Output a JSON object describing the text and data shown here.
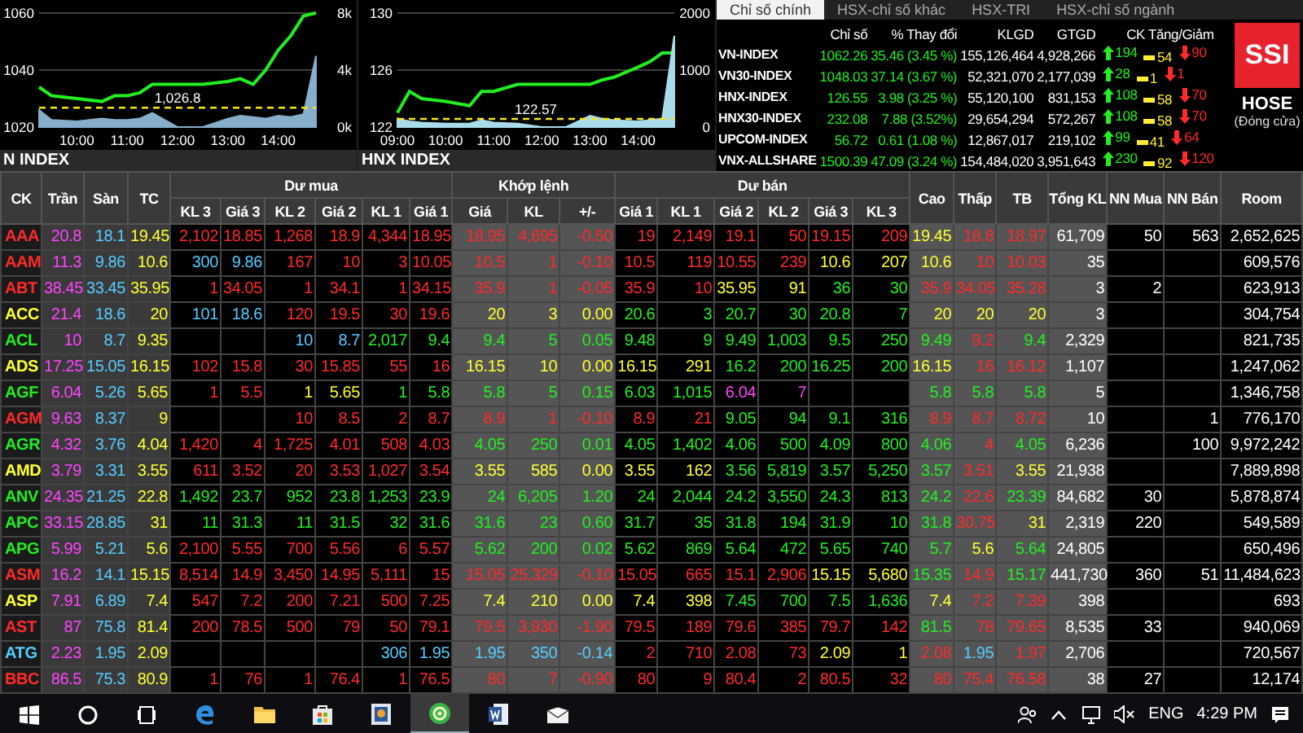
{
  "charts": [
    {
      "label": "N INDEX",
      "chart_data": {
        "type": "line",
        "xlim": [
          9.25,
          14.75
        ],
        "ylim": [
          1020,
          1060
        ],
        "xticks": [
          {
            "value": 10,
            "label": "10:00"
          },
          {
            "value": 11,
            "label": "11:00"
          },
          {
            "value": 12,
            "label": "12:00"
          },
          {
            "value": 13,
            "label": "13:00"
          },
          {
            "value": 14,
            "label": "14:00"
          }
        ],
        "yticks": [
          1020,
          1040,
          1060
        ],
        "y2lim": [
          0,
          8000
        ],
        "y2ticks": [
          {
            "value": 0,
            "label": "0k"
          },
          {
            "value": 4000,
            "label": "4k"
          },
          {
            "value": 8000,
            "label": "8k"
          }
        ],
        "x": [
          9.25,
          9.5,
          10,
          10.5,
          10.75,
          11,
          11.25,
          11.5,
          12,
          12.5,
          13,
          13.25,
          13.5,
          13.75,
          14,
          14.25,
          14.5,
          14.75
        ],
        "series": [
          {
            "color": "#22ee22",
            "values": [
              1034,
              1031,
              1030,
              1029,
              1031,
              1031,
              1032,
              1035,
              1035,
              1035,
              1036,
              1037,
              1035,
              1040,
              1047,
              1052,
              1059,
              1060
            ]
          },
          {
            "type": "area",
            "axis": "y2",
            "color": "#86aecb",
            "values": [
              1200,
              500,
              400,
              600,
              500,
              500,
              600,
              1000,
              0,
              0,
              600,
              800,
              700,
              600,
              800,
              700,
              900,
              5000
            ]
          },
          {
            "name": "1,026.8",
            "line_style": "dashed",
            "color": "#f5e51a",
            "values": [
              1026.8,
              1026.8,
              1026.8,
              1026.8,
              1026.8,
              1026.8,
              1026.8,
              1026.8,
              1026.8,
              1026.8,
              1026.8,
              1026.8,
              1026.8,
              1026.8,
              1026.8,
              1026.8,
              1026.8,
              1026.8
            ]
          }
        ]
      }
    },
    {
      "label": "HNX INDEX",
      "chart_data": {
        "type": "line",
        "xlim": [
          9,
          14.75
        ],
        "ylim": [
          122,
          130
        ],
        "xticks": [
          {
            "value": 9,
            "label": "09:00"
          },
          {
            "value": 10,
            "label": "10:00"
          },
          {
            "value": 11,
            "label": "11:00"
          },
          {
            "value": 12,
            "label": "12:00"
          },
          {
            "value": 13,
            "label": "13:00"
          },
          {
            "value": 14,
            "label": "14:00"
          }
        ],
        "yticks": [
          122,
          126,
          130
        ],
        "y2lim": [
          0,
          2000
        ],
        "y2ticks": [
          0,
          1000,
          2000
        ],
        "x": [
          9,
          9.25,
          9.5,
          10,
          10.5,
          10.75,
          11,
          11.5,
          12,
          12.5,
          13,
          13.25,
          13.5,
          14,
          14.25,
          14.5,
          14.75
        ],
        "series": [
          {
            "color": "#22ee22",
            "values": [
              123,
              124.5,
              124,
              123.8,
              123.5,
              124.5,
              124.5,
              125,
              125,
              125,
              125,
              125.3,
              125.5,
              126.2,
              126.6,
              127.2,
              127.2
            ]
          },
          {
            "type": "area",
            "axis": "y2",
            "color": "#a8dcea",
            "values": [
              150,
              100,
              80,
              60,
              60,
              120,
              80,
              60,
              0,
              0,
              200,
              150,
              120,
              100,
              120,
              150,
              1600
            ]
          },
          {
            "name": "122.57",
            "line_style": "dashed",
            "color": "#f5e51a",
            "values": [
              122.57,
              122.57,
              122.57,
              122.57,
              122.57,
              122.57,
              122.57,
              122.57,
              122.57,
              122.57,
              122.57,
              122.57,
              122.57,
              122.57,
              122.57,
              122.57,
              122.57
            ]
          }
        ]
      }
    }
  ],
  "index_panel": {
    "tabs": [
      {
        "label": "Chỉ số chính",
        "selected": true
      },
      {
        "label": "HSX-chỉ số khác",
        "selected": false
      },
      {
        "label": "HSX-TRI",
        "selected": false
      },
      {
        "label": "HSX-chỉ số ngành",
        "selected": false
      }
    ],
    "columns": [
      "Chỉ số",
      "% Thay đổi",
      "KLGD",
      "GTGD",
      "CK Tăng/Giảm"
    ],
    "rows": [
      {
        "name": "VN-INDEX",
        "value": "1062.26",
        "change": "35.46 (3.45 %)",
        "klgd": "155,126,464",
        "gtgd": "4,928,266",
        "up": "194",
        "flat": "54",
        "down": "90"
      },
      {
        "name": "VN30-INDEX",
        "value": "1048.03",
        "change": "37.14 (3.67 %)",
        "klgd": "52,321,070",
        "gtgd": "2,177,039",
        "up": "28",
        "flat": "1",
        "down": "1"
      },
      {
        "name": "HNX-INDEX",
        "value": "126.55",
        "change": "3.98 (3.25 %)",
        "klgd": "55,120,100",
        "gtgd": "831,153",
        "up": "108",
        "flat": "58",
        "down": "70"
      },
      {
        "name": "HNX30-INDEX",
        "value": "232.08",
        "change": "7.88 (3.52%)",
        "klgd": "29,654,294",
        "gtgd": "572,267",
        "up": "108",
        "flat": "58",
        "down": "70"
      },
      {
        "name": "UPCOM-INDEX",
        "value": "56.72",
        "change": "0.61 (1.08 %)",
        "klgd": "12,867,017",
        "gtgd": "219,102",
        "up": "99",
        "flat": "41",
        "down": "64"
      },
      {
        "name": "VNX-ALLSHARE",
        "value": "1500.39",
        "change": "47.09 (3.24 %)",
        "klgd": "154,484,020",
        "gtgd": "3,951,643",
        "up": "230",
        "flat": "92",
        "down": "120"
      }
    ],
    "logo": "SSI",
    "exchange": "HOSE",
    "status": "(Đóng cửa)"
  },
  "board": {
    "header": [
      {
        "label": "CK"
      },
      {
        "label": "Trần"
      },
      {
        "label": "Sàn"
      },
      {
        "label": "TC"
      },
      {
        "label": "Dư mua",
        "columns": [
          "KL 3",
          "Giá 3",
          "KL 2",
          "Giá 2",
          "KL 1",
          "Giá 1"
        ]
      },
      {
        "label": "Khớp lệnh",
        "columns": [
          "Giá",
          "KL",
          "+/-"
        ]
      },
      {
        "label": "Dư bán",
        "columns": [
          "Giá 1",
          "KL 1",
          "Giá 2",
          "KL 2",
          "Giá 3",
          "KL 3"
        ]
      },
      {
        "label": "Cao"
      },
      {
        "label": "Thấp"
      },
      {
        "label": "TB"
      },
      {
        "label": "Tổng KL"
      },
      {
        "label": "NN Mua"
      },
      {
        "label": "NN Bán"
      },
      {
        "label": "Room"
      }
    ],
    "rows": [
      [
        "AAA",
        "20.8",
        "18.1",
        "19.45",
        "2,102",
        "18.85",
        "1,268",
        "18.9",
        "4,344",
        "18.95",
        "18.95",
        "4,695",
        "-0.50",
        "19",
        "2,149",
        "19.1",
        "50",
        "19.15",
        "209",
        "19.45",
        "18.8",
        "18.97",
        "61,709",
        "50",
        "563",
        "2,652,625"
      ],
      [
        "AAM",
        "11.3",
        "9.86",
        "10.6",
        "300",
        "9.86",
        "167",
        "10",
        "3",
        "10.05",
        "10.5",
        "1",
        "-0.10",
        "10.5",
        "119",
        "10.55",
        "239",
        "10.6",
        "207",
        "10.6",
        "10",
        "10.03",
        "35",
        null,
        null,
        "609,576"
      ],
      [
        "ABT",
        "38.45",
        "33.45",
        "35.95",
        "1",
        "34.05",
        "1",
        "34.1",
        "1",
        "34.15",
        "35.9",
        "1",
        "-0.05",
        "35.9",
        "10",
        "35.95",
        "91",
        "36",
        "30",
        "35.9",
        "34.05",
        "35.28",
        "3",
        "2",
        null,
        "623,913"
      ],
      [
        "ACC",
        "21.4",
        "18.6",
        "20",
        "101",
        "18.6",
        "120",
        "19.5",
        "30",
        "19.6",
        "20",
        "3",
        "0.00",
        "20.6",
        "3",
        "20.7",
        "30",
        "20.8",
        "7",
        "20",
        "20",
        "20",
        "3",
        null,
        null,
        "304,754"
      ],
      [
        "ACL",
        "10",
        "8.7",
        "9.35",
        null,
        null,
        "10",
        "8.7",
        "2,017",
        "9.4",
        "9.4",
        "5",
        "0.05",
        "9.48",
        "9",
        "9.49",
        "1,003",
        "9.5",
        "250",
        "9.49",
        "9.2",
        "9.4",
        "2,329",
        null,
        null,
        "821,735"
      ],
      [
        "ADS",
        "17.25",
        "15.05",
        "16.15",
        "102",
        "15.8",
        "30",
        "15.85",
        "55",
        "16",
        "16.15",
        "10",
        "0.00",
        "16.15",
        "291",
        "16.2",
        "200",
        "16.25",
        "200",
        "16.15",
        "16",
        "16.12",
        "1,107",
        null,
        null,
        "1,247,062"
      ],
      [
        "AGF",
        "6.04",
        "5.26",
        "5.65",
        "1",
        "5.5",
        "1",
        "5.65",
        "1",
        "5.8",
        "5.8",
        "5",
        "0.15",
        "6.03",
        "1,015",
        "6.04",
        "7",
        null,
        null,
        "5.8",
        "5.8",
        "5.8",
        "5",
        null,
        null,
        "1,346,758"
      ],
      [
        "AGM",
        "9.63",
        "8.37",
        "9",
        null,
        null,
        "10",
        "8.5",
        "2",
        "8.7",
        "8.9",
        "1",
        "-0.10",
        "8.9",
        "21",
        "9.05",
        "94",
        "9.1",
        "316",
        "8.9",
        "8.7",
        "8.72",
        "10",
        null,
        "1",
        "776,170"
      ],
      [
        "AGR",
        "4.32",
        "3.76",
        "4.04",
        "1,420",
        "4",
        "1,725",
        "4.01",
        "508",
        "4.03",
        "4.05",
        "250",
        "0.01",
        "4.05",
        "1,402",
        "4.06",
        "500",
        "4.09",
        "800",
        "4.06",
        "4",
        "4.05",
        "6,236",
        null,
        "100",
        "9,972,242"
      ],
      [
        "AMD",
        "3.79",
        "3.31",
        "3.55",
        "611",
        "3.52",
        "20",
        "3.53",
        "1,027",
        "3.54",
        "3.55",
        "585",
        "0.00",
        "3.55",
        "162",
        "3.56",
        "5,819",
        "3.57",
        "5,250",
        "3.57",
        "3.51",
        "3.55",
        "21,938",
        null,
        null,
        "7,889,898"
      ],
      [
        "ANV",
        "24.35",
        "21.25",
        "22.8",
        "1,492",
        "23.7",
        "952",
        "23.8",
        "1,253",
        "23.9",
        "24",
        "6,205",
        "1.20",
        "24",
        "2,044",
        "24.2",
        "3,550",
        "24.3",
        "813",
        "24.2",
        "22.6",
        "23.39",
        "84,682",
        "30",
        null,
        "5,878,874"
      ],
      [
        "APC",
        "33.15",
        "28.85",
        "31",
        "11",
        "31.3",
        "11",
        "31.5",
        "32",
        "31.6",
        "31.6",
        "23",
        "0.60",
        "31.7",
        "35",
        "31.8",
        "194",
        "31.9",
        "10",
        "31.8",
        "30.75",
        "31",
        "2,319",
        "220",
        null,
        "549,589"
      ],
      [
        "APG",
        "5.99",
        "5.21",
        "5.6",
        "2,100",
        "5.55",
        "700",
        "5.56",
        "6",
        "5.57",
        "5.62",
        "200",
        "0.02",
        "5.62",
        "869",
        "5.64",
        "472",
        "5.65",
        "740",
        "5.7",
        "5.6",
        "5.64",
        "24,805",
        null,
        null,
        "650,496"
      ],
      [
        "ASM",
        "16.2",
        "14.1",
        "15.15",
        "8,514",
        "14.9",
        "3,450",
        "14.95",
        "5,111",
        "15",
        "15.05",
        "25,329",
        "-0.10",
        "15.05",
        "665",
        "15.1",
        "2,906",
        "15.15",
        "5,680",
        "15.35",
        "14.9",
        "15.17",
        "441,730",
        "360",
        "51",
        "11,484,623"
      ],
      [
        "ASP",
        "7.91",
        "6.89",
        "7.4",
        "547",
        "7.2",
        "200",
        "7.21",
        "500",
        "7.25",
        "7.4",
        "210",
        "0.00",
        "7.4",
        "398",
        "7.45",
        "700",
        "7.5",
        "1,636",
        "7.4",
        "7.2",
        "7.39",
        "398",
        null,
        null,
        "693"
      ],
      [
        "AST",
        "87",
        "75.8",
        "81.4",
        "200",
        "78.5",
        "500",
        "79",
        "50",
        "79.1",
        "79.5",
        "3,930",
        "-1.90",
        "79.5",
        "189",
        "79.6",
        "385",
        "79.7",
        "142",
        "81.5",
        "78",
        "79.65",
        "8,535",
        "33",
        null,
        "940,069"
      ],
      [
        "ATG",
        "2.23",
        "1.95",
        "2.09",
        null,
        null,
        null,
        null,
        "306",
        "1.95",
        "1.95",
        "350",
        "-0.14",
        "2",
        "710",
        "2.08",
        "73",
        "2.09",
        "1",
        "2.08",
        "1.95",
        "1.97",
        "2,706",
        null,
        null,
        "720,567"
      ],
      [
        "BBC",
        "86.5",
        "75.3",
        "80.9",
        "1",
        "76",
        "1",
        "76.4",
        "1",
        "76.5",
        "80",
        "7",
        "-0.90",
        "80",
        "9",
        "80.4",
        "2",
        "80.5",
        "32",
        "80",
        "75.4",
        "76.58",
        "38",
        "27",
        null,
        "12,174"
      ]
    ]
  },
  "taskbar": {
    "items": [
      {
        "kind": "start",
        "selected": false
      },
      {
        "kind": "search",
        "selected": false
      },
      {
        "kind": "task-view",
        "selected": false
      },
      {
        "kind": "browser",
        "selected": false
      },
      {
        "kind": "folder",
        "selected": false
      },
      {
        "kind": "store",
        "selected": false
      },
      {
        "kind": "app",
        "selected": false
      },
      {
        "kind": "green-app",
        "selected": true
      },
      {
        "kind": "word",
        "selected": false
      },
      {
        "kind": "mail",
        "selected": false
      }
    ],
    "tray": {
      "language": "ENG",
      "time": "4:29 PM"
    }
  }
}
